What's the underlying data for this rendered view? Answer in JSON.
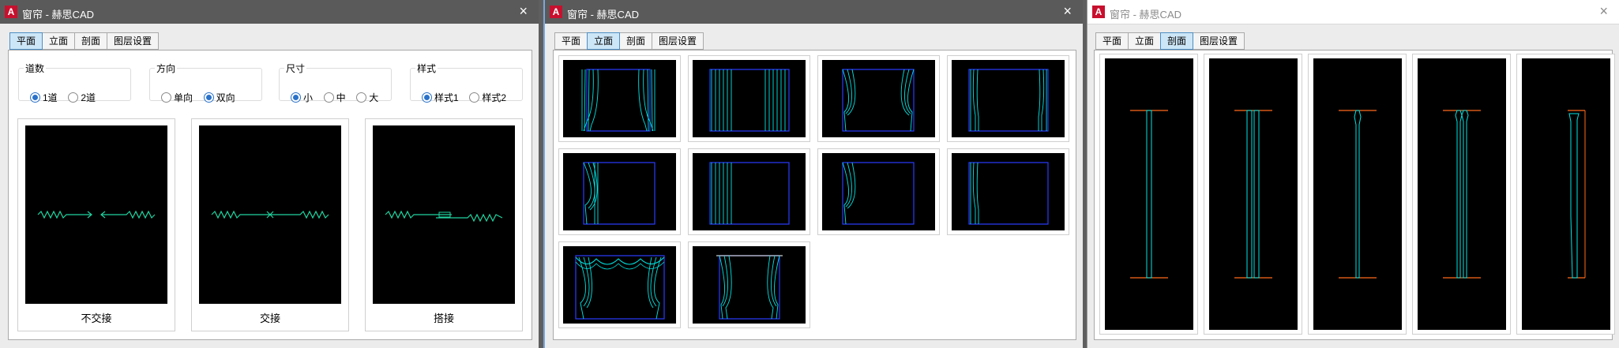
{
  "windows": [
    {
      "title": "窗帘 - 赫思CAD",
      "close": "×",
      "tabs": [
        "平面",
        "立面",
        "剖面",
        "图层设置"
      ],
      "active_tab": "平面",
      "groups": [
        {
          "label": "道数",
          "options": [
            "1道",
            "2道"
          ],
          "selected": "1道"
        },
        {
          "label": "方向",
          "options": [
            "单向",
            "双向"
          ],
          "selected": "双向"
        },
        {
          "label": "尺寸",
          "options": [
            "小",
            "中",
            "大"
          ],
          "selected": "小"
        },
        {
          "label": "样式",
          "options": [
            "样式1",
            "样式2"
          ],
          "selected": "样式1"
        }
      ],
      "previews": [
        "不交接",
        "交接",
        "搭接"
      ]
    },
    {
      "title": "窗帘 - 赫思CAD",
      "close": "×",
      "tabs": [
        "平面",
        "立面",
        "剖面",
        "图层设置"
      ],
      "active_tab": "立面",
      "thumbnail_count": 10
    },
    {
      "title": "窗帘 - 赫思CAD",
      "close": "×",
      "tabs": [
        "平面",
        "立面",
        "剖面",
        "图层设置"
      ],
      "active_tab": "剖面",
      "section_count": 5
    }
  ],
  "app_icon": "A",
  "colors": {
    "accent": "#2a72c9",
    "cad_cyan": "#00e5e5",
    "cad_blue": "#2a3cff",
    "cad_green": "#20d4a0",
    "cad_orange": "#ff6a1a"
  }
}
